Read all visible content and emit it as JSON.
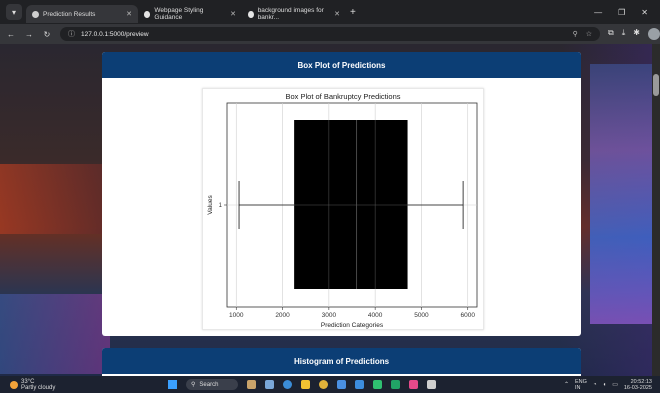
{
  "browser": {
    "tabs": [
      {
        "label": "Prediction Results",
        "active": true
      },
      {
        "label": "Webpage Styling Guidance",
        "active": false
      },
      {
        "label": "background images for bankr...",
        "active": false
      }
    ],
    "url": "127.0.0.1:5000/preview"
  },
  "page": {
    "card1_title": "Box Plot of Predictions",
    "card2_title": "Histogram of Predictions"
  },
  "chart_data": {
    "type": "box",
    "title": "Box Plot of Bankruptcy Predictions",
    "xlabel": "Prediction Categories",
    "ylabel": "Values",
    "category": "1",
    "orientation": "horizontal",
    "xlim": [
      800,
      6200
    ],
    "xticks": [
      1000,
      2000,
      3000,
      4000,
      5000,
      6000
    ],
    "box": {
      "whisker_low": 1060,
      "q1": 2250,
      "median": 3600,
      "q3": 4700,
      "whisker_high": 5900
    },
    "box_color": "#000000",
    "grid": true
  },
  "taskbar": {
    "temperature": "33°C",
    "weather": "Partly cloudy",
    "search": "Search",
    "lang": "ENG",
    "lang2": "IN",
    "time": "20:52:13",
    "date": "16-03-2025"
  }
}
